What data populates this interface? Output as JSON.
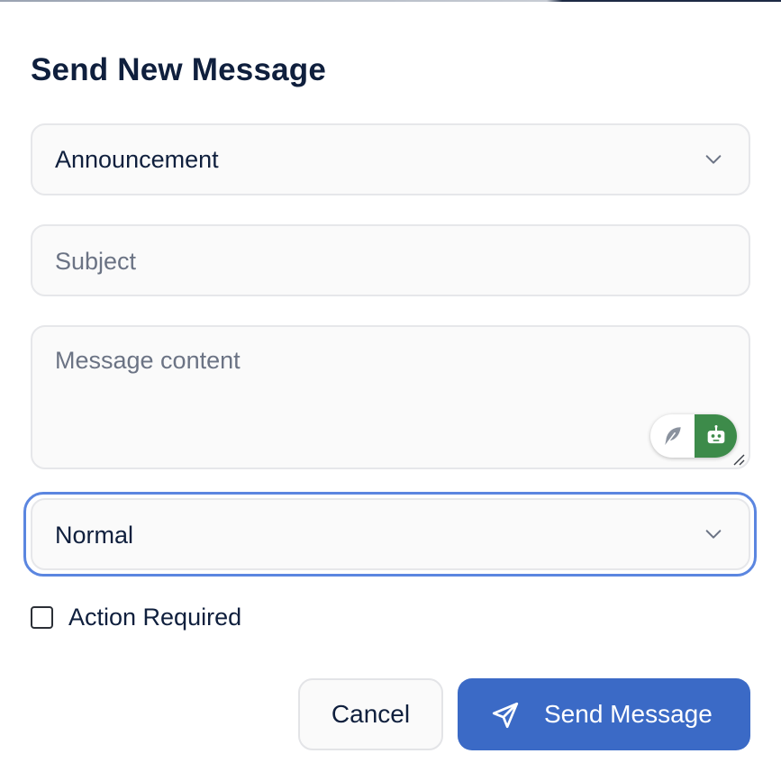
{
  "dialog": {
    "title": "Send New Message"
  },
  "form": {
    "message_type": {
      "selected": "Announcement"
    },
    "subject": {
      "placeholder": "Subject"
    },
    "content": {
      "placeholder": "Message content"
    },
    "priority": {
      "selected": "Normal"
    },
    "action_required": {
      "label": "Action Required",
      "checked": false
    }
  },
  "buttons": {
    "cancel_label": "Cancel",
    "send_label": "Send Message"
  },
  "colors": {
    "primary": "#3b6ac6",
    "focus_ring": "#5b86e0",
    "assistant_green": "#3d8b4a"
  },
  "icons": {
    "dropdown": "chevron-down-icon",
    "writing_tool": "feather-icon",
    "assistant": "robot-icon",
    "send": "paper-plane-icon"
  }
}
